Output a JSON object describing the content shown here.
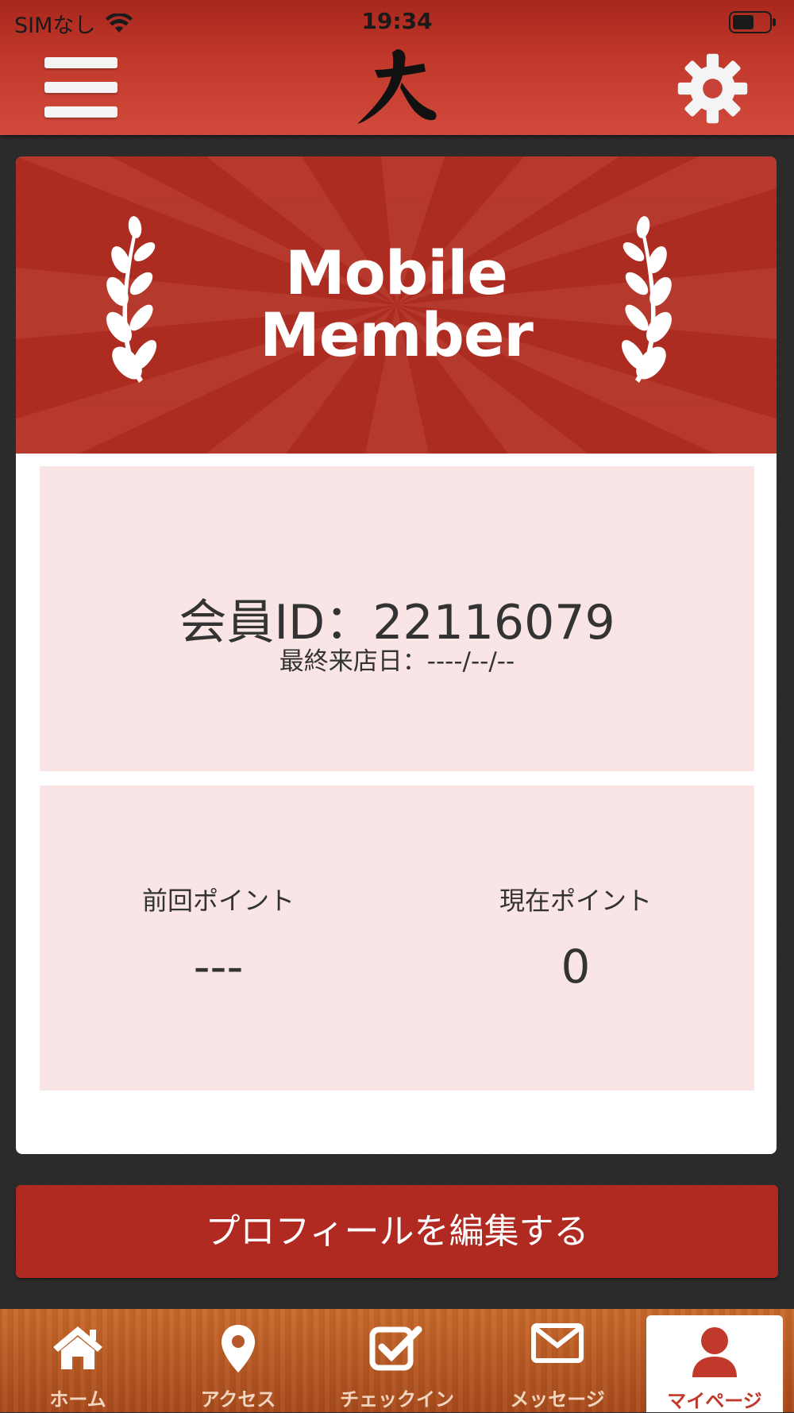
{
  "status_bar": {
    "carrier": "SIMなし",
    "time": "19:34"
  },
  "header": {
    "logo_char": "大",
    "menu_icon": "hamburger-menu-icon",
    "settings_icon": "gear-icon"
  },
  "banner": {
    "title_line1": "Mobile",
    "title_line2": "Member"
  },
  "member": {
    "id_text": "会員ID：22116079",
    "last_visit_text": "最終来店日：----/--/--"
  },
  "points": {
    "previous_label": "前回ポイント",
    "previous_value": "---",
    "current_label": "現在ポイント",
    "current_value": "0"
  },
  "actions": {
    "edit_profile_label": "プロフィールを編集する"
  },
  "tabbar": {
    "items": [
      {
        "label": "ホーム",
        "icon": "home-icon"
      },
      {
        "label": "アクセス",
        "icon": "map-pin-icon"
      },
      {
        "label": "チェックイン",
        "icon": "checkbox-icon"
      },
      {
        "label": "メッセージ",
        "icon": "envelope-icon"
      },
      {
        "label": "マイページ",
        "icon": "user-icon",
        "active": true
      }
    ]
  },
  "colors": {
    "header_red": "#c1392b",
    "banner_red": "#ad2c22",
    "panel_pink": "#f9e5e5",
    "button_red": "#b02a21",
    "tabbar_wood": "#b8572a"
  }
}
